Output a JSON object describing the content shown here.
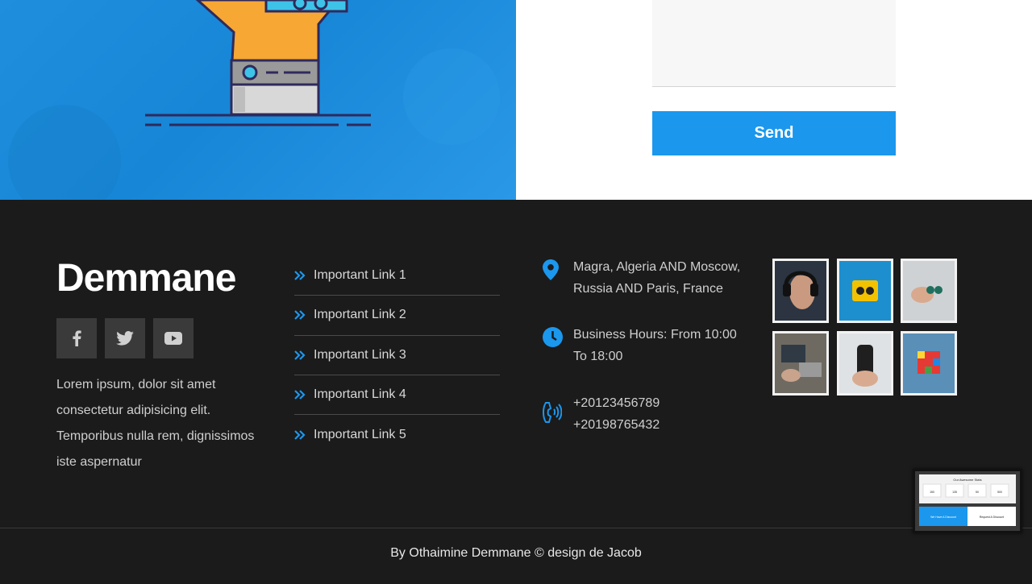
{
  "form": {
    "message_value": "",
    "send_label": "Send"
  },
  "footer": {
    "brand": "Demmane",
    "socials": [
      {
        "icon": "facebook-icon"
      },
      {
        "icon": "twitter-icon"
      },
      {
        "icon": "youtube-icon"
      }
    ],
    "about": "Lorem ipsum, dolor sit amet consectetur adipisicing elit. Temporibus nulla rem, dignissimos iste aspernatur",
    "links": [
      {
        "label": "Important Link 1"
      },
      {
        "label": "Important Link 2"
      },
      {
        "label": "Important Link 3"
      },
      {
        "label": "Important Link 4"
      },
      {
        "label": "Important Link 5"
      }
    ],
    "contact": {
      "address": "Magra, Algeria AND Moscow, Russia AND Paris, France",
      "hours": "Business Hours: From 10:00 To 18:00",
      "phone1": "+20123456789",
      "phone2": "+20198765432"
    },
    "copyright": "By Othaimine Demmane © design de Jacob"
  },
  "preview": {
    "title": "Our Awesome Stats",
    "stats": [
      "150",
      "135",
      "50",
      "500"
    ],
    "left_heading": "We Have A Discount",
    "right_heading": "Request A Discount"
  },
  "colors": {
    "accent": "#1b97ee",
    "footer_bg": "#1b1b1b"
  }
}
